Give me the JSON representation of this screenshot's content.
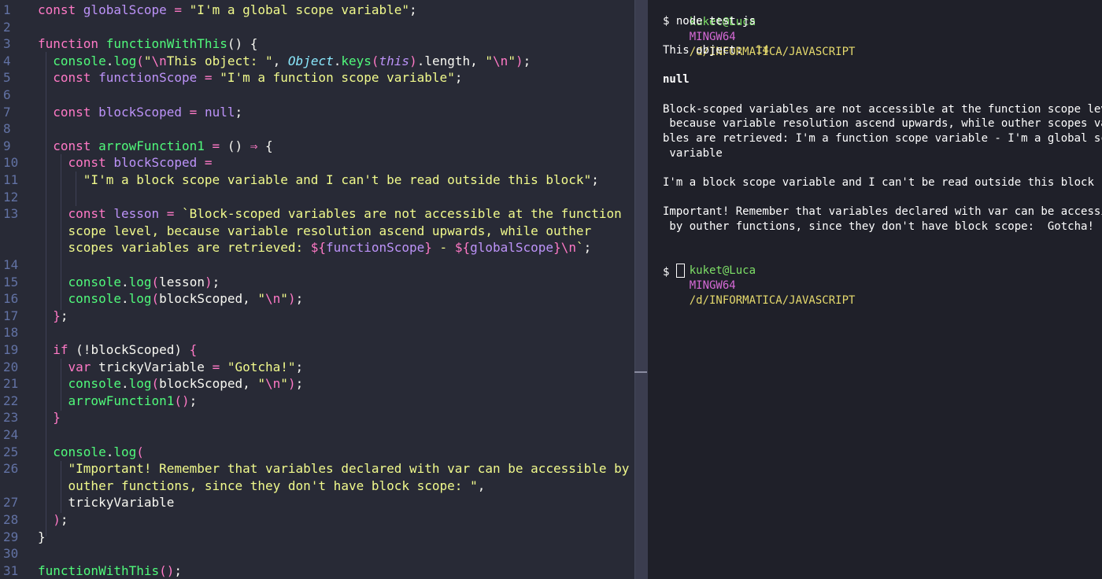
{
  "editor": {
    "lines": [
      {
        "n": "1",
        "tokens": [
          [
            "k",
            "const "
          ],
          [
            "v",
            "globalScope"
          ],
          [
            "o",
            " = "
          ],
          [
            "s",
            "\"I'm a global scope variable\""
          ],
          [
            "p",
            ";"
          ]
        ]
      },
      {
        "n": "2",
        "tokens": []
      },
      {
        "n": "3",
        "tokens": [
          [
            "k",
            "function "
          ],
          [
            "f",
            "functionWithThis"
          ],
          [
            "p",
            "() {"
          ]
        ]
      },
      {
        "n": "4",
        "tokens": [
          [
            "f",
            "  console"
          ],
          [
            "p",
            "."
          ],
          [
            "f",
            "log"
          ],
          [
            "b",
            "("
          ],
          [
            "s",
            "\""
          ],
          [
            "e",
            "\\n"
          ],
          [
            "s",
            "This object: \""
          ],
          [
            "p",
            ", "
          ],
          [
            "cl",
            "Object"
          ],
          [
            "p",
            "."
          ],
          [
            "f",
            "keys"
          ],
          [
            "b",
            "("
          ],
          [
            "th",
            "this"
          ],
          [
            "b",
            ")"
          ],
          [
            "p",
            ".length, "
          ],
          [
            "s",
            "\""
          ],
          [
            "e",
            "\\n"
          ],
          [
            "s",
            "\""
          ],
          [
            "b",
            ")"
          ],
          [
            "p",
            ";"
          ]
        ]
      },
      {
        "n": "5",
        "tokens": [
          [
            "k",
            "  const "
          ],
          [
            "v",
            "functionScope"
          ],
          [
            "o",
            " = "
          ],
          [
            "s",
            "\"I'm a function scope variable\""
          ],
          [
            "p",
            ";"
          ]
        ]
      },
      {
        "n": "6",
        "tokens": []
      },
      {
        "n": "7",
        "tokens": [
          [
            "k",
            "  const "
          ],
          [
            "v",
            "blockScoped"
          ],
          [
            "o",
            " = "
          ],
          [
            "n",
            "null"
          ],
          [
            "p",
            ";"
          ]
        ]
      },
      {
        "n": "8",
        "tokens": []
      },
      {
        "n": "9",
        "tokens": [
          [
            "k",
            "  const "
          ],
          [
            "f",
            "arrowFunction1"
          ],
          [
            "o",
            " = "
          ],
          [
            "p",
            "() "
          ],
          [
            "o",
            "⇒"
          ],
          [
            "p",
            " {"
          ]
        ]
      },
      {
        "n": "10",
        "tokens": [
          [
            "k",
            "    const "
          ],
          [
            "v",
            "blockScoped"
          ],
          [
            "o",
            " ="
          ]
        ]
      },
      {
        "n": "11",
        "tokens": [
          [
            "s",
            "      \"I'm a block scope variable and I can't be read outside this block\""
          ],
          [
            "p",
            ";"
          ]
        ]
      },
      {
        "n": "12",
        "tokens": []
      },
      {
        "n": "13",
        "tokens": [
          [
            "k",
            "    const "
          ],
          [
            "v",
            "lesson"
          ],
          [
            "o",
            " = "
          ],
          [
            "s",
            "`Block-scoped variables are not accessible at the function"
          ]
        ]
      },
      {
        "n": "",
        "tokens": [
          [
            "s",
            "    scope level, because variable resolution ascend upwards, while outher"
          ]
        ]
      },
      {
        "n": "",
        "tokens": [
          [
            "s",
            "    scopes variables are retrieved: "
          ],
          [
            "tp",
            "${"
          ],
          [
            "v",
            "functionScope"
          ],
          [
            "tp",
            "}"
          ],
          [
            "s",
            " - "
          ],
          [
            "tp",
            "${"
          ],
          [
            "v",
            "globalScope"
          ],
          [
            "tp",
            "}"
          ],
          [
            "e",
            "\\n"
          ],
          [
            "s",
            "`"
          ],
          [
            "p",
            ";"
          ]
        ]
      },
      {
        "n": "14",
        "tokens": []
      },
      {
        "n": "15",
        "tokens": [
          [
            "f",
            "    console"
          ],
          [
            "p",
            "."
          ],
          [
            "f",
            "log"
          ],
          [
            "b",
            "("
          ],
          [
            "p",
            "lesson"
          ],
          [
            "b",
            ")"
          ],
          [
            "p",
            ";"
          ]
        ]
      },
      {
        "n": "16",
        "tokens": [
          [
            "f",
            "    console"
          ],
          [
            "p",
            "."
          ],
          [
            "f",
            "log"
          ],
          [
            "b",
            "("
          ],
          [
            "p",
            "blockScoped, "
          ],
          [
            "s",
            "\""
          ],
          [
            "e",
            "\\n"
          ],
          [
            "s",
            "\""
          ],
          [
            "b",
            ")"
          ],
          [
            "p",
            ";"
          ]
        ]
      },
      {
        "n": "17",
        "tokens": [
          [
            "b",
            "  }"
          ],
          [
            "p",
            ";"
          ]
        ]
      },
      {
        "n": "18",
        "tokens": []
      },
      {
        "n": "19",
        "tokens": [
          [
            "k",
            "  if "
          ],
          [
            "p",
            "(!blockScoped) "
          ],
          [
            "b",
            "{"
          ]
        ]
      },
      {
        "n": "20",
        "tokens": [
          [
            "k",
            "    var "
          ],
          [
            "p",
            "trickyVariable "
          ],
          [
            "o",
            "="
          ],
          [
            "s",
            " \"Gotcha!\""
          ],
          [
            "p",
            ";"
          ]
        ]
      },
      {
        "n": "21",
        "tokens": [
          [
            "f",
            "    console"
          ],
          [
            "p",
            "."
          ],
          [
            "f",
            "log"
          ],
          [
            "b",
            "("
          ],
          [
            "p",
            "blockScoped, "
          ],
          [
            "s",
            "\""
          ],
          [
            "e",
            "\\n"
          ],
          [
            "s",
            "\""
          ],
          [
            "b",
            ")"
          ],
          [
            "p",
            ";"
          ]
        ]
      },
      {
        "n": "22",
        "tokens": [
          [
            "f",
            "    arrowFunction1"
          ],
          [
            "b",
            "()"
          ],
          [
            "p",
            ";"
          ]
        ]
      },
      {
        "n": "23",
        "tokens": [
          [
            "b",
            "  }"
          ]
        ]
      },
      {
        "n": "24",
        "tokens": []
      },
      {
        "n": "25",
        "tokens": [
          [
            "f",
            "  console"
          ],
          [
            "p",
            "."
          ],
          [
            "f",
            "log"
          ],
          [
            "b",
            "("
          ]
        ]
      },
      {
        "n": "26",
        "tokens": [
          [
            "s",
            "    \"Important! Remember that variables declared with var can be accessible by"
          ]
        ]
      },
      {
        "n": "",
        "tokens": [
          [
            "s",
            "    outher functions, since they don't have block scope: \""
          ],
          [
            "p",
            ","
          ]
        ]
      },
      {
        "n": "27",
        "tokens": [
          [
            "p",
            "    trickyVariable"
          ]
        ]
      },
      {
        "n": "28",
        "tokens": [
          [
            "b",
            "  )"
          ],
          [
            "p",
            ";"
          ]
        ]
      },
      {
        "n": "29",
        "tokens": [
          [
            "p",
            "}"
          ]
        ]
      },
      {
        "n": "30",
        "tokens": []
      },
      {
        "n": "31",
        "tokens": [
          [
            "f",
            "functionWithThis"
          ],
          [
            "b",
            "()"
          ],
          [
            "p",
            ";"
          ]
        ]
      }
    ]
  },
  "terminal": {
    "prompt_user": "kuket@Luca",
    "prompt_host": "MINGW64",
    "prompt_path": "/d/INFORMATICA/JAVASCRIPT",
    "command": "$ node test.js",
    "this_object_label": "This object:  ",
    "this_object_value": "14",
    "null_output": "null",
    "lesson_output": [
      "Block-scoped variables are not accessible at the function scope level,",
      " because variable resolution ascend upwards, while outher scopes varia",
      "bles are retrieved: I'm a function scope variable - I'm a global scope",
      " variable"
    ],
    "block_output": "I'm a block scope variable and I can't be read outside this block",
    "important_output": [
      "Important! Remember that variables declared with var can be accessible",
      " by outher functions, since they don't have block scope:  Gotcha!"
    ],
    "final_prompt": "$ "
  },
  "colors": {
    "editor_bg": "#282a36",
    "terminal_bg": "#1f2029",
    "keyword": "#ff79c6",
    "function": "#50fa7b",
    "variable": "#bd93f9",
    "string": "#f1fa8c",
    "class": "#8be9fd",
    "line_number": "#6272a4",
    "term_user": "#7ee067",
    "term_host": "#d56ad6",
    "term_path": "#e6da6d"
  }
}
